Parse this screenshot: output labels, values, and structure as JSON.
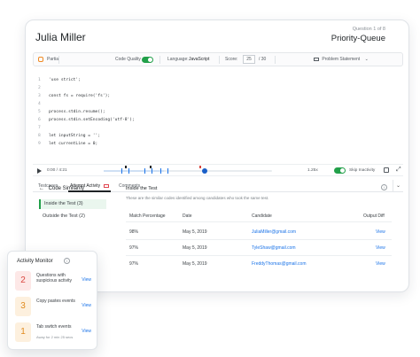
{
  "header": {
    "candidate_name": "Julia Miller",
    "question_number": "Question 1 of 8",
    "question_title": "Priority-Queue"
  },
  "toolbar": {
    "status": "Partial",
    "code_quality_label": "Code Quality",
    "code_quality_on": true,
    "language_label": "Language:",
    "language_value": "JavaScript",
    "score_label": "Score:",
    "score_value": "25",
    "score_total": "/ 30",
    "problem_statement": "Problem Statement"
  },
  "code": {
    "lines": [
      {
        "num": "1",
        "text": "'use strict';"
      },
      {
        "num": "2",
        "text": ""
      },
      {
        "num": "3",
        "text": "const fs = require('fs');"
      },
      {
        "num": "4",
        "text": ""
      },
      {
        "num": "5",
        "text": "process.stdin.resume();"
      },
      {
        "num": "6",
        "text": "process.stdin.setEncoding('utf-8');"
      },
      {
        "num": "7",
        "text": ""
      },
      {
        "num": "8",
        "text": "let inputString = '';"
      },
      {
        "num": "9",
        "text": "let currentLine = 0;"
      }
    ]
  },
  "player": {
    "time": "0:00 / 4:21",
    "progress": 0.6,
    "speed": "1.25x",
    "skip_inactivity_label": "Skip Inactivity",
    "skip_inactivity_on": true
  },
  "tabs": [
    {
      "label": "Testcases",
      "active": false
    },
    {
      "label": "Attempt Activity",
      "active": true
    },
    {
      "label": "Comments",
      "active": false
    }
  ],
  "similarity": {
    "header": "Code Similarity",
    "items": [
      {
        "label": "Inside the Test (3)",
        "active": true
      },
      {
        "label": "Outside the Test (2)",
        "active": false
      }
    ],
    "section_title": "Inside the Test",
    "section_desc": "These are the similar codes identified among candidates who took the same test.",
    "columns": [
      "Match Percentage",
      "Date",
      "Candidate",
      "Output Diff"
    ],
    "rows": [
      {
        "match": "98%",
        "date": "May 5, 2019",
        "candidate": "JuliaMiller@gmail.com",
        "action": "View"
      },
      {
        "match": "97%",
        "date": "May 5, 2019",
        "candidate": "TyleShaw@gmail.com",
        "action": "View"
      },
      {
        "match": "97%",
        "date": "May 5, 2019",
        "candidate": "FreddyThomas@gmail.com",
        "action": "View"
      }
    ]
  },
  "monitor": {
    "title": "Activity Monitor",
    "items": [
      {
        "count": "2",
        "label": "Questions with suspicious activity",
        "sub": "",
        "action": "View",
        "bg": "#fde8e7",
        "fg": "#d9463e"
      },
      {
        "count": "3",
        "label": "Copy pastes events",
        "sub": "",
        "action": "View",
        "bg": "#fdf0de",
        "fg": "#e08a1e"
      },
      {
        "count": "1",
        "label": "Tab switch events",
        "sub": "Away for 2 min 25 secs",
        "action": "View",
        "bg": "#fdf0de",
        "fg": "#e08a1e"
      }
    ]
  },
  "colors": {
    "accent_green": "#22a04a",
    "link_blue": "#1a73e8"
  }
}
